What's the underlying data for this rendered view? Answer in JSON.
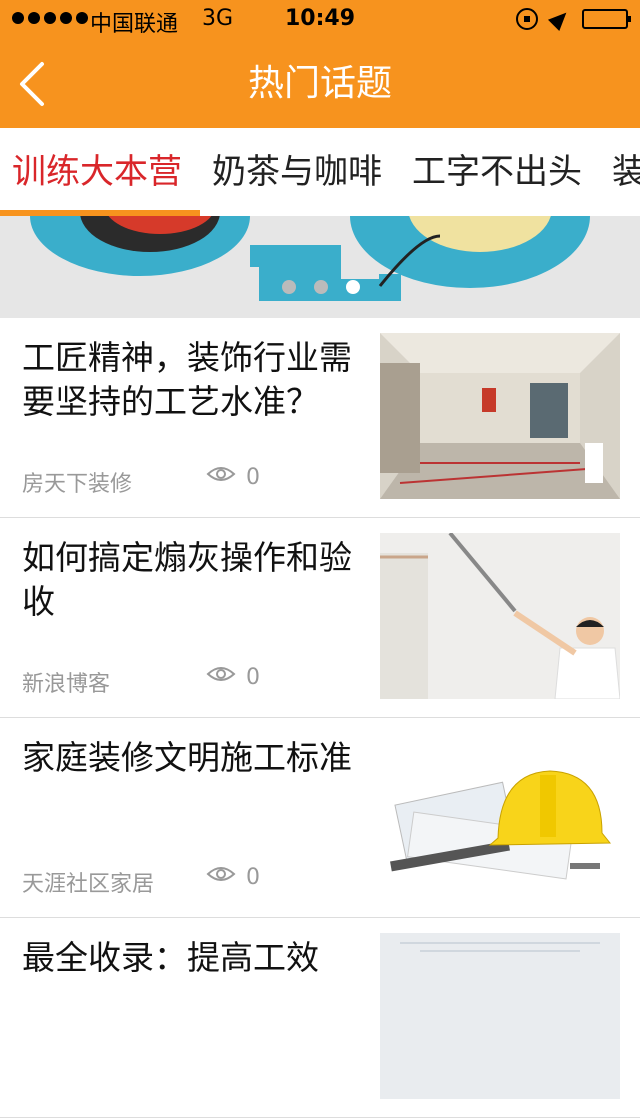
{
  "status_bar": {
    "carrier": "中国联通",
    "network": "3G",
    "time": "10:49",
    "battery_level": 0.8
  },
  "nav": {
    "title": "热门话题",
    "back_icon": "chevron-left-icon"
  },
  "tabs": [
    {
      "label": "训练大本营",
      "active": true
    },
    {
      "label": "奶茶与咖啡",
      "active": false
    },
    {
      "label": "工字不出头",
      "active": false
    },
    {
      "label": "装",
      "active": false
    }
  ],
  "banner": {
    "slides": 3,
    "active_slide": 3
  },
  "articles": [
    {
      "title": "工匠精神，装饰行业需要坚持的工艺水准？",
      "source": "房天下装修",
      "views": "0",
      "thumb": "empty-room-photo"
    },
    {
      "title": "如何搞定煽灰操作和验收",
      "source": "新浪博客",
      "views": "0",
      "thumb": "wall-inspection-photo"
    },
    {
      "title": "家庭装修文明施工标准",
      "source": "天涯社区家居",
      "views": "0",
      "thumb": "hard-hat-blueprints-photo"
    },
    {
      "title": "最全收录：提高工效",
      "source": "",
      "views": "",
      "thumb": "blueprint-photo"
    }
  ],
  "colors": {
    "brand": "#f7931e",
    "active_tab": "#d9262a"
  }
}
